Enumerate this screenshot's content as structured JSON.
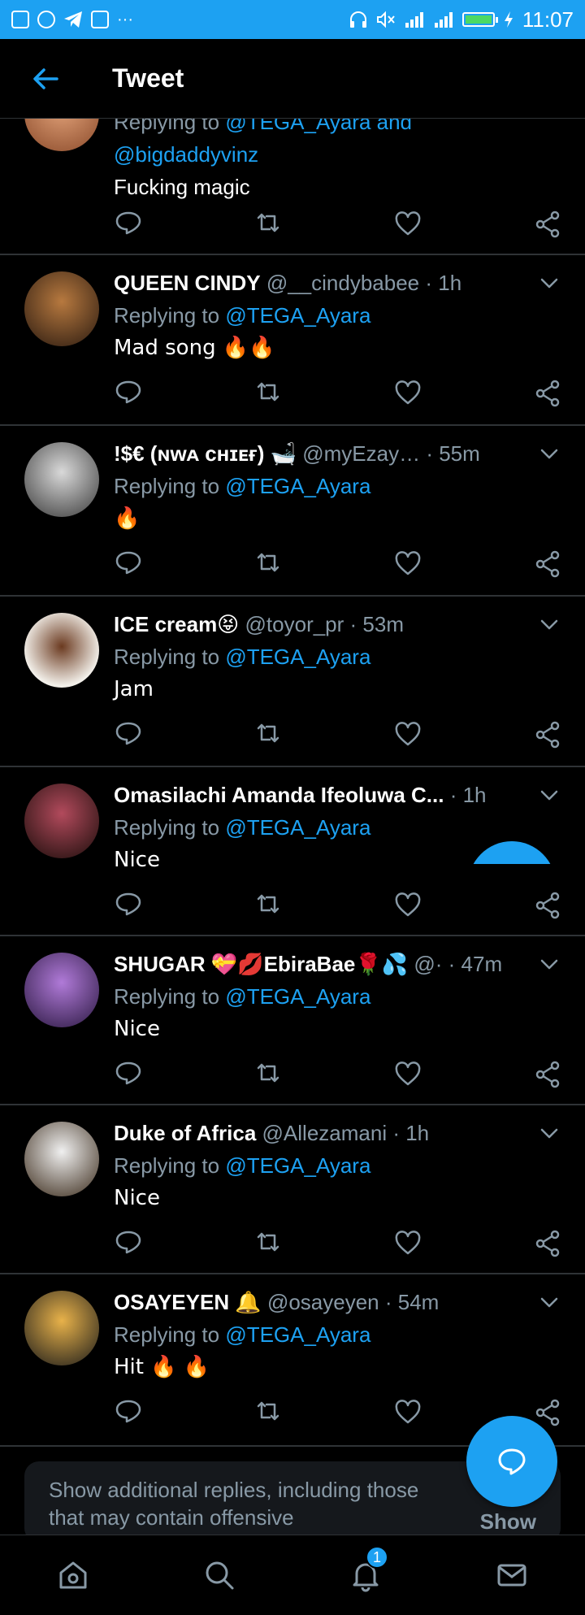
{
  "status_bar": {
    "time": "11:07",
    "left_icons": [
      "image-icon",
      "instagram-icon",
      "telegram-icon",
      "gallery-icon"
    ],
    "more": "···",
    "right_icons": [
      "headphones-icon",
      "mute-icon",
      "signal-icon",
      "signal-icon",
      "battery-icon",
      "charging-icon"
    ],
    "battery_level": 1.0
  },
  "header": {
    "title": "Tweet",
    "back_icon": "back-arrow-icon"
  },
  "colors": {
    "accent": "#1da1f2",
    "background": "#000000",
    "muted": "#8899a6",
    "divider": "#2f3336"
  },
  "tweets": [
    {
      "partial": true,
      "replying_prefix": "Replying to",
      "replying_to": "@TEGA_Ayara",
      "replying_and": "and",
      "replying_second": "@bigdaddyvinz",
      "text": "Fucking magic"
    },
    {
      "name": "QUEEN CINDY",
      "handle": "@__cindybabee",
      "time": "· 1h",
      "replying_prefix": "Replying to",
      "replying_to": "@TEGA_Ayara",
      "text": "Mad song 🔥🔥"
    },
    {
      "name": "!$€ (ɴᴡᴀ ᴄʜɪᴇғ) 🛁",
      "handle": "@myEzay…",
      "time": "· 55m",
      "replying_prefix": "Replying to",
      "replying_to": "@TEGA_Ayara",
      "text": "🔥"
    },
    {
      "name": "ICE cream😝",
      "handle": "@toyor_pr",
      "time": "· 53m",
      "replying_prefix": "Replying to",
      "replying_to": "@TEGA_Ayara",
      "text": "Jam"
    },
    {
      "name": "Omasilachi Amanda Ifeoluwa C...",
      "handle": "",
      "time": "· 1h",
      "replying_prefix": "Replying to",
      "replying_to": "@TEGA_Ayara",
      "text": "Nice"
    },
    {
      "name": "SHUGAR 💝💋EbiraBae🌹💦",
      "handle": "@·",
      "time": "· 47m",
      "replying_prefix": "Replying to",
      "replying_to": "@TEGA_Ayara",
      "text": "Nice"
    },
    {
      "name": "Duke of Africa",
      "handle": "@Allezamani",
      "time": "· 1h",
      "replying_prefix": "Replying to",
      "replying_to": "@TEGA_Ayara",
      "text": "Nice"
    },
    {
      "name": "OSAYEYEN 🔔",
      "handle": "@osayeyen",
      "time": "· 54m",
      "replying_prefix": "Replying to",
      "replying_to": "@TEGA_Ayara",
      "text": "Hit 🔥 🔥"
    }
  ],
  "more_replies": {
    "text": "Show additional replies, including those that may contain offensive",
    "button": "Show"
  },
  "compose_fab_icon": "reply-bubble-icon",
  "bottom_nav": {
    "items": [
      "home-icon",
      "search-icon",
      "notifications-icon",
      "messages-icon"
    ],
    "notification_count": "1"
  }
}
